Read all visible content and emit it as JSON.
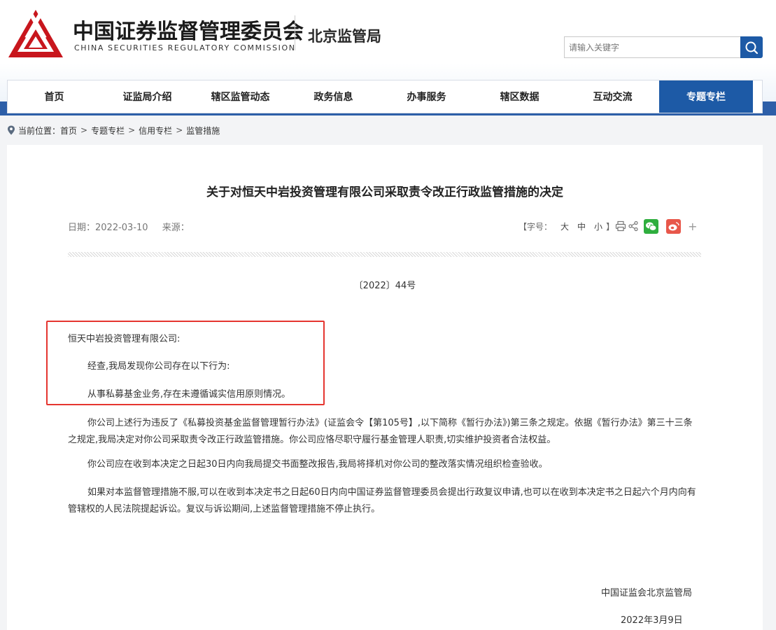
{
  "header": {
    "org_name_cn": "中国证券监督管理委员会",
    "org_name_en": "CHINA SECURITIES REGULATORY COMMISSION",
    "bureau_name": "北京监管局",
    "search_placeholder": "请输入关键字",
    "brand_color": "#1d5aa6",
    "logo_color": "#c8161d"
  },
  "nav": {
    "items": [
      {
        "label": "首页"
      },
      {
        "label": "证监局介绍"
      },
      {
        "label": "辖区监管动态"
      },
      {
        "label": "政务信息"
      },
      {
        "label": "办事服务"
      },
      {
        "label": "辖区数据"
      },
      {
        "label": "互动交流"
      },
      {
        "label": "专题专栏",
        "active": true
      }
    ]
  },
  "breadcrumb": {
    "prefix": "当前位置：",
    "items": [
      "首页",
      "专题专栏",
      "信用专栏",
      "监管措施"
    ],
    "separator": ">"
  },
  "article": {
    "title": "关于对恒天中岩投资管理有限公司采取责令改正行政监管措施的决定",
    "date_label": "日期：",
    "date": "2022-03-10",
    "source_label": "来源：",
    "source": "",
    "font_size_label": "【字号：",
    "font_sizes": [
      "大",
      "中",
      "小"
    ],
    "font_size_close": "】",
    "doc_number": "〔2022〕44号",
    "addressee": "恒天中岩投资管理有限公司:",
    "paragraphs": [
      "经查,我局发现你公司存在以下行为:",
      "从事私募基金业务,存在未遵循诚实信用原则情况。",
      "你公司上述行为违反了《私募投资基金监督管理暂行办法》(证监会令【第105号】,以下简称《暂行办法》)第三条之规定。依据《暂行办法》第三十三条之规定,我局决定对你公司采取责令改正行政监管措施。你公司应恪尽职守履行基金管理人职责,切实维护投资者合法权益。",
      "你公司应在收到本决定之日起30日内向我局提交书面整改报告,我局将择机对你公司的整改落实情况组织检查验收。",
      "如果对本监督管理措施不服,可以在收到本决定书之日起60日内向中国证券监督管理委员会提出行政复议申请,也可以在收到本决定书之日起六个月内向有管辖权的人民法院提起诉讼。复议与诉讼期间,上述监督管理措施不停止执行。"
    ],
    "signature_org": "中国证监会北京监管局",
    "signature_date": "2022年3月9日",
    "highlight_color": "#e53530"
  }
}
